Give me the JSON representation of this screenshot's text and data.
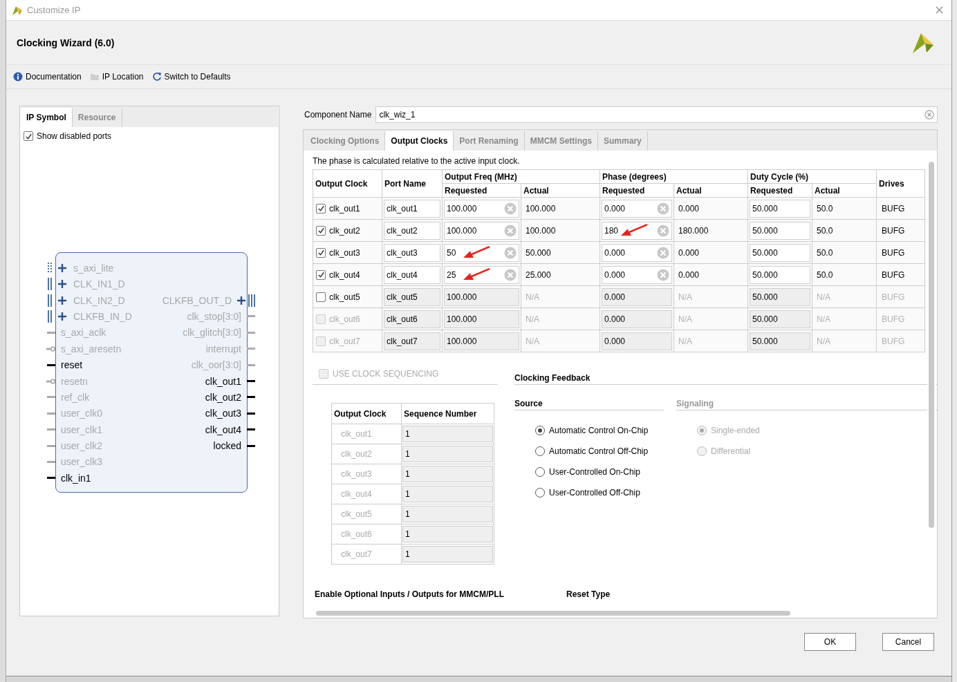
{
  "window": {
    "title": "Customize IP"
  },
  "header": {
    "title": "Clocking Wizard (6.0)"
  },
  "toolbar": [
    {
      "label": "Documentation"
    },
    {
      "label": "IP Location"
    },
    {
      "label": "Switch to Defaults"
    }
  ],
  "left_tabs": [
    {
      "label": "IP Symbol",
      "selected": true
    },
    {
      "label": "Resource",
      "selected": false
    }
  ],
  "show_disabled": {
    "label": "Show disabled ports",
    "checked": true
  },
  "symbol": {
    "rows": [
      {
        "left": {
          "name": "s_axi_lite",
          "kind": "axi",
          "enabled": false
        }
      },
      {
        "left": {
          "name": "CLK_IN1_D",
          "kind": "bus",
          "enabled": false
        }
      },
      {
        "left": {
          "name": "CLK_IN2_D",
          "kind": "bus",
          "enabled": false
        },
        "right": {
          "name": "CLKFB_OUT_D",
          "kind": "bus",
          "enabled": false
        }
      },
      {
        "left": {
          "name": "CLKFB_IN_D",
          "kind": "bus",
          "enabled": false
        },
        "right": {
          "name": "clk_stop[3:0]",
          "kind": "pin",
          "enabled": false
        }
      },
      {
        "left": {
          "name": "s_axi_aclk",
          "kind": "pin",
          "enabled": false
        },
        "right": {
          "name": "clk_glitch[3:0]",
          "kind": "pin",
          "enabled": false
        }
      },
      {
        "left": {
          "name": "s_axi_aresetn",
          "kind": "bubble",
          "enabled": false
        },
        "right": {
          "name": "interrupt",
          "kind": "pin",
          "enabled": false
        }
      },
      {
        "left": {
          "name": "reset",
          "kind": "pin",
          "enabled": true
        },
        "right": {
          "name": "clk_oor[3:0]",
          "kind": "pin",
          "enabled": false
        }
      },
      {
        "left": {
          "name": "resetn",
          "kind": "bubble",
          "enabled": false
        },
        "right": {
          "name": "clk_out1",
          "kind": "pin",
          "enabled": true
        }
      },
      {
        "left": {
          "name": "ref_clk",
          "kind": "pin",
          "enabled": false
        },
        "right": {
          "name": "clk_out2",
          "kind": "pin",
          "enabled": true
        }
      },
      {
        "left": {
          "name": "user_clk0",
          "kind": "pin",
          "enabled": false
        },
        "right": {
          "name": "clk_out3",
          "kind": "pin",
          "enabled": true
        }
      },
      {
        "left": {
          "name": "user_clk1",
          "kind": "pin",
          "enabled": false
        },
        "right": {
          "name": "clk_out4",
          "kind": "pin",
          "enabled": true
        }
      },
      {
        "left": {
          "name": "user_clk2",
          "kind": "pin",
          "enabled": false
        },
        "right": {
          "name": "locked",
          "kind": "pin",
          "enabled": true
        }
      },
      {
        "left": {
          "name": "user_clk3",
          "kind": "pin",
          "enabled": false
        }
      },
      {
        "left": {
          "name": "clk_in1",
          "kind": "pin",
          "enabled": true
        }
      }
    ]
  },
  "component_name": {
    "label": "Component Name",
    "value": "clk_wiz_1"
  },
  "tabs": [
    {
      "label": "Clocking Options",
      "selected": false
    },
    {
      "label": "Output Clocks",
      "selected": true
    },
    {
      "label": "Port Renaming",
      "selected": false
    },
    {
      "label": "MMCM Settings",
      "selected": false
    },
    {
      "label": "Summary",
      "selected": false
    }
  ],
  "note": "The phase is calculated relative to the active input clock.",
  "table": {
    "columns": [
      "Output Clock",
      "Port Name",
      "Drives"
    ],
    "groups": [
      {
        "label": "Output Freq (MHz)",
        "sub": [
          "Requested",
          "Actual"
        ]
      },
      {
        "label": "Phase (degrees)",
        "sub": [
          "Requested",
          "Actual"
        ]
      },
      {
        "label": "Duty Cycle (%)",
        "sub": [
          "Requested",
          "Actual"
        ]
      }
    ],
    "rows": [
      {
        "clock": "clk_out1",
        "checked": true,
        "checkbox_disabled": false,
        "active": true,
        "port": "clk_out1",
        "freq_req": "100.000",
        "freq_act": "100.000",
        "phase_req": "0.000",
        "phase_act": "0.000",
        "duty_req": "50.000",
        "duty_act": "50.0",
        "drives": "BUFG",
        "freq_arrow": false,
        "phase_arrow": false
      },
      {
        "clock": "clk_out2",
        "checked": true,
        "checkbox_disabled": false,
        "active": true,
        "port": "clk_out2",
        "freq_req": "100.000",
        "freq_act": "100.000",
        "phase_req": "180",
        "phase_act": "180.000",
        "duty_req": "50.000",
        "duty_act": "50.0",
        "drives": "BUFG",
        "freq_arrow": false,
        "phase_arrow": true
      },
      {
        "clock": "clk_out3",
        "checked": true,
        "checkbox_disabled": false,
        "active": true,
        "port": "clk_out3",
        "freq_req": "50",
        "freq_act": "50.000",
        "phase_req": "0.000",
        "phase_act": "0.000",
        "duty_req": "50.000",
        "duty_act": "50.0",
        "drives": "BUFG",
        "freq_arrow": true,
        "phase_arrow": false
      },
      {
        "clock": "clk_out4",
        "checked": true,
        "checkbox_disabled": false,
        "active": true,
        "port": "clk_out4",
        "freq_req": "25",
        "freq_act": "25.000",
        "phase_req": "0.000",
        "phase_act": "0.000",
        "duty_req": "50.000",
        "duty_act": "50.0",
        "drives": "BUFG",
        "freq_arrow": true,
        "phase_arrow": false
      },
      {
        "clock": "clk_out5",
        "checked": false,
        "checkbox_disabled": false,
        "active": false,
        "port": "clk_out5",
        "freq_req": "100.000",
        "freq_act": "N/A",
        "phase_req": "0.000",
        "phase_act": "N/A",
        "duty_req": "50.000",
        "duty_act": "N/A",
        "drives": "BUFG",
        "freq_arrow": false,
        "phase_arrow": false
      },
      {
        "clock": "clk_out6",
        "checked": false,
        "checkbox_disabled": true,
        "active": false,
        "port": "clk_out6",
        "freq_req": "100.000",
        "freq_act": "N/A",
        "phase_req": "0.000",
        "phase_act": "N/A",
        "duty_req": "50.000",
        "duty_act": "N/A",
        "drives": "BUFG",
        "freq_arrow": false,
        "phase_arrow": false
      },
      {
        "clock": "clk_out7",
        "checked": false,
        "checkbox_disabled": true,
        "active": false,
        "port": "clk_out7",
        "freq_req": "100.000",
        "freq_act": "N/A",
        "phase_req": "0.000",
        "phase_act": "N/A",
        "duty_req": "50.000",
        "duty_act": "N/A",
        "drives": "BUFG",
        "freq_arrow": false,
        "phase_arrow": false
      }
    ]
  },
  "sequencing": {
    "label": "USE CLOCK SEQUENCING",
    "checked": false,
    "disabled": true,
    "columns": [
      "Output Clock",
      "Sequence Number"
    ],
    "rows": [
      {
        "clock": "clk_out1",
        "number": "1"
      },
      {
        "clock": "clk_out2",
        "number": "1"
      },
      {
        "clock": "clk_out3",
        "number": "1"
      },
      {
        "clock": "clk_out4",
        "number": "1"
      },
      {
        "clock": "clk_out5",
        "number": "1"
      },
      {
        "clock": "clk_out6",
        "number": "1"
      },
      {
        "clock": "clk_out7",
        "number": "1"
      }
    ]
  },
  "feedback": {
    "title": "Clocking Feedback",
    "source": {
      "title": "Source",
      "disabled": false,
      "options": [
        {
          "label": "Automatic Control On-Chip",
          "selected": true
        },
        {
          "label": "Automatic Control Off-Chip",
          "selected": false
        },
        {
          "label": "User-Controlled On-Chip",
          "selected": false
        },
        {
          "label": "User-Controlled Off-Chip",
          "selected": false
        }
      ]
    },
    "signaling": {
      "title": "Signaling",
      "disabled": true,
      "options": [
        {
          "label": "Single-ended",
          "selected": true
        },
        {
          "label": "Differential",
          "selected": false
        }
      ]
    }
  },
  "bottom_sections": [
    "Enable Optional Inputs / Outputs for MMCM/PLL",
    "Reset Type"
  ],
  "buttons": [
    "OK",
    "Cancel"
  ]
}
